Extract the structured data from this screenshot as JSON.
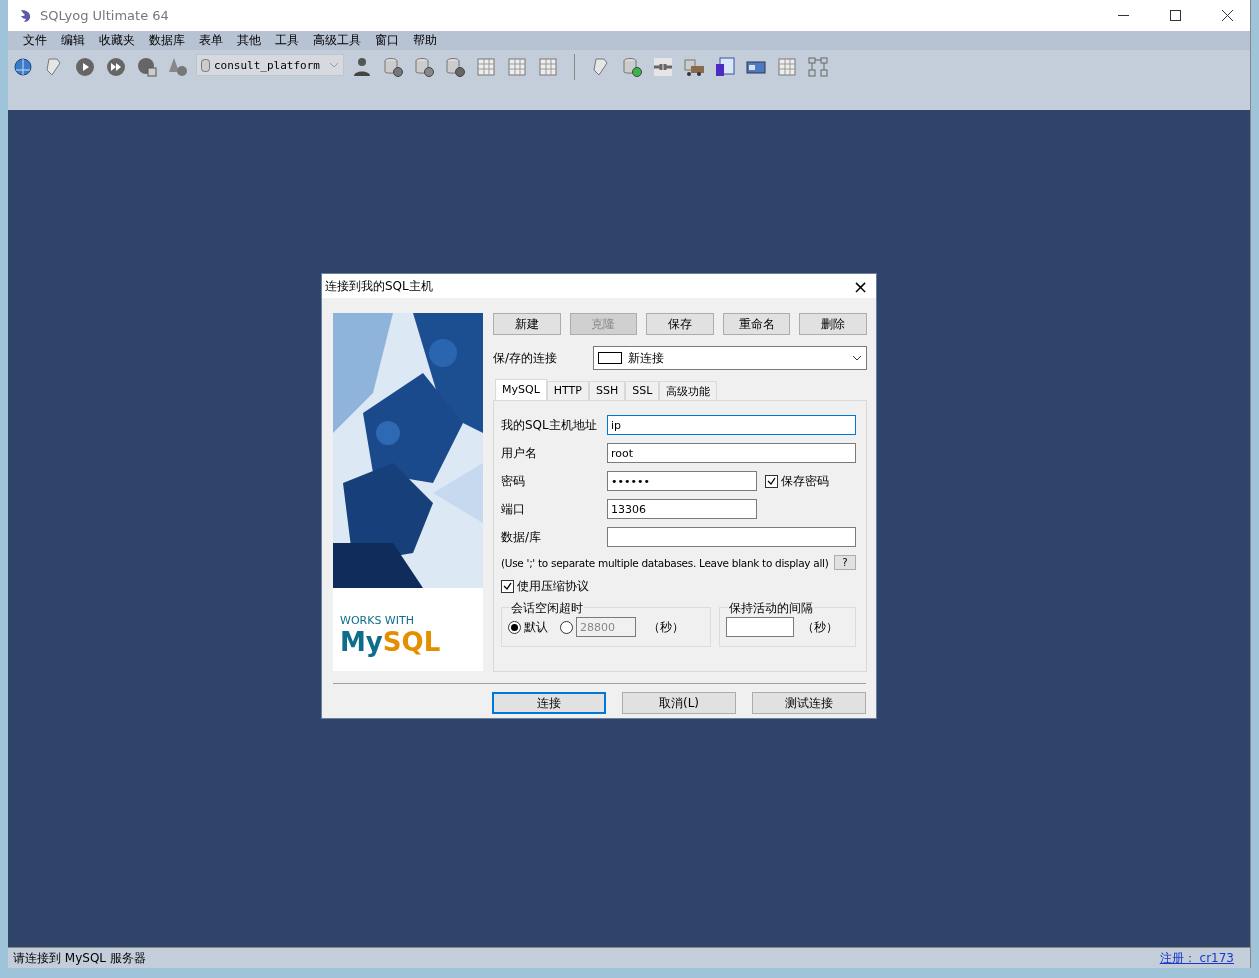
{
  "window": {
    "title": "SQLyog Ultimate 64"
  },
  "menu": [
    "文件",
    "编辑",
    "收藏夹",
    "数据库",
    "表单",
    "其他",
    "工具",
    "高级工具",
    "窗口",
    "帮助"
  ],
  "toolbar": {
    "database": "consult_platform"
  },
  "dialog": {
    "title": "连接到我的SQL主机",
    "close": "×",
    "actions": [
      {
        "label": "新建",
        "disabled": false
      },
      {
        "label": "克隆",
        "disabled": true
      },
      {
        "label": "保存",
        "disabled": false
      },
      {
        "label": "重命名",
        "disabled": false
      },
      {
        "label": "删除",
        "disabled": false
      }
    ],
    "saved_connection": {
      "label": "保/存的连接",
      "value": "新连接"
    },
    "tabs": [
      {
        "label": "MySQL",
        "selected": true
      },
      {
        "label": "HTTP",
        "selected": false
      },
      {
        "label": "SSH",
        "selected": false
      },
      {
        "label": "SSL",
        "selected": false
      },
      {
        "label": "高级功能",
        "selected": false
      }
    ],
    "fields": [
      {
        "label": "我的SQL主机地址",
        "value": "ip",
        "wide": true,
        "focused": true
      },
      {
        "label": "用户名",
        "value": "root",
        "wide": true,
        "focused": false
      },
      {
        "label": "密码",
        "value": "••••••",
        "wide": false,
        "focused": false
      },
      {
        "label": "端口",
        "value": "13306",
        "wide": false,
        "focused": false
      },
      {
        "label": "数据/库",
        "wide": true,
        "focused": false
      }
    ],
    "save_password": {
      "label": "保存密码",
      "checked": true
    },
    "hint": "(Use ';' to separate multiple databases. Leave blank to display all)",
    "help": "?",
    "compression": {
      "label": "使用压缩协议",
      "checked": true
    },
    "session_timeout": {
      "title": "会话空闲超时",
      "options": [
        {
          "label": "默认",
          "selected": true
        },
        {
          "value": "28800",
          "selected": false
        }
      ],
      "unit": "（秒）"
    },
    "keepalive": {
      "title": "保持活动的间隔",
      "unit": "（秒）"
    },
    "logo": {
      "small": "WORKS WITH",
      "my": "My",
      "sql": "SQL"
    },
    "footer": [
      {
        "label": "连接",
        "default": true
      },
      {
        "label": "取消(L)",
        "default": false
      },
      {
        "label": "测试连接",
        "default": false
      }
    ]
  },
  "status_bar": {
    "text": "请连接到 MySQL 服务器",
    "link": "注册： cr173"
  }
}
